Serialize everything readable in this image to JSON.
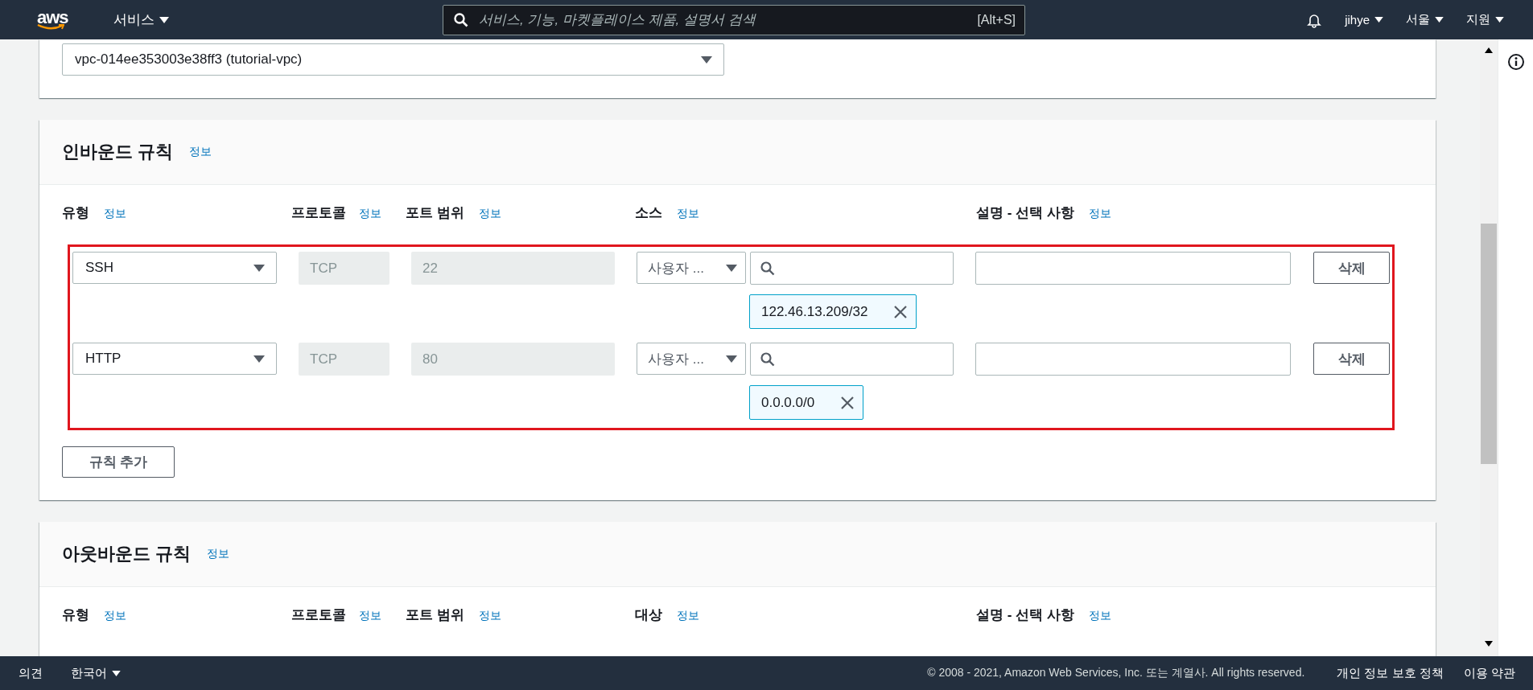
{
  "nav": {
    "logo": "aws",
    "services": "서비스",
    "search_placeholder": "서비스, 기능, 마켓플레이스 제품, 설명서 검색",
    "search_shortcut": "[Alt+S]",
    "user": "jihye",
    "region": "서울",
    "support": "지원"
  },
  "vpc_select": {
    "value": "vpc-014ee353003e38ff3 (tutorial-vpc)"
  },
  "inbound": {
    "title": "인바운드 규칙",
    "info": "정보",
    "highlighted": true,
    "columns": [
      {
        "label": "유형",
        "info": "정보"
      },
      {
        "label": "프로토콜",
        "info": "정보"
      },
      {
        "label": "포트 범위",
        "info": "정보"
      },
      {
        "label": "소스",
        "info": "정보"
      },
      {
        "label": "설명 - 선택 사항",
        "info": "정보"
      }
    ],
    "rules": [
      {
        "type": "SSH",
        "protocol": "TCP",
        "port": "22",
        "source": "사용자 ...",
        "tags": [
          "122.46.13.209/32"
        ],
        "delete": "삭제"
      },
      {
        "type": "HTTP",
        "protocol": "TCP",
        "port": "80",
        "source": "사용자 ...",
        "tags": [
          "0.0.0.0/0"
        ],
        "delete": "삭제"
      }
    ],
    "add_button": "규칙 추가"
  },
  "outbound": {
    "title": "아웃바운드 규칙",
    "info": "정보",
    "columns": [
      {
        "label": "유형",
        "info": "정보"
      },
      {
        "label": "프로토콜",
        "info": "정보"
      },
      {
        "label": "포트 범위",
        "info": "정보"
      },
      {
        "label": "대상",
        "info": "정보"
      },
      {
        "label": "설명 - 선택 사항",
        "info": "정보"
      }
    ]
  },
  "footer": {
    "feedback": "의견",
    "language": "한국어",
    "copyright": "© 2008 - 2021, Amazon Web Services, Inc. 또는 계열사. All rights reserved.",
    "links": [
      "개인 정보 보호 정책",
      "이용 약관"
    ]
  }
}
